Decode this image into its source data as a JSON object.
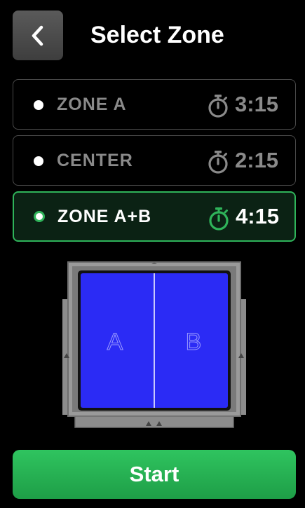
{
  "header": {
    "title": "Select Zone",
    "back_icon": "chevron-left-icon"
  },
  "zones": [
    {
      "label": "ZONE A",
      "time": "3:15",
      "selected": false,
      "icon": "timer-icon"
    },
    {
      "label": "CENTER",
      "time": "2:15",
      "selected": false,
      "icon": "timer-icon"
    },
    {
      "label": "ZONE A+B",
      "time": "4:15",
      "selected": true,
      "icon": "timer-icon"
    }
  ],
  "diagram": {
    "left_zone_label": "A",
    "right_zone_label": "B",
    "zone_color": "#2b2bf5"
  },
  "actions": {
    "start_label": "Start"
  },
  "colors": {
    "accent": "#2fb45a",
    "background": "#000000",
    "muted_text": "#8a8a8a"
  }
}
